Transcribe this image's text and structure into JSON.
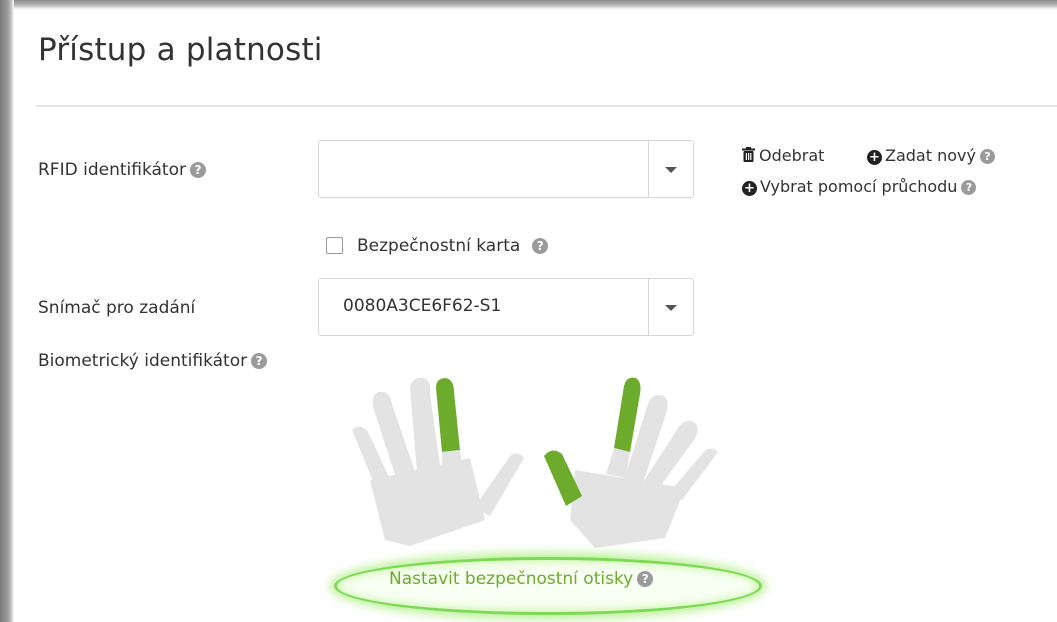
{
  "section": {
    "title": "Přístup a platnosti"
  },
  "rfid": {
    "label": "RFID identifikátor",
    "value": "",
    "actions": {
      "remove": "Odebrat",
      "add_new": "Zadat nový",
      "select_by_passage": "Vybrat pomocí průchodu"
    }
  },
  "security_card": {
    "label": "Bezpečnostní karta",
    "checked": false
  },
  "reader": {
    "label": "Snímač pro zadání",
    "value": "0080A3CE6F62-S1"
  },
  "biometric": {
    "label": "Biometrický identifikátor",
    "selected_fingers": [
      "left-index",
      "right-thumb",
      "right-index"
    ],
    "highlight_color": "#6cab2c",
    "hand_color": "#e3e3e3"
  },
  "fingerprint_link": {
    "label": "Nastavit bezpečnostní otisky"
  },
  "icons": {
    "help": "question-circle-icon",
    "trash": "trash-icon",
    "plus": "plus-circle-icon",
    "caret": "caret-down-icon"
  }
}
